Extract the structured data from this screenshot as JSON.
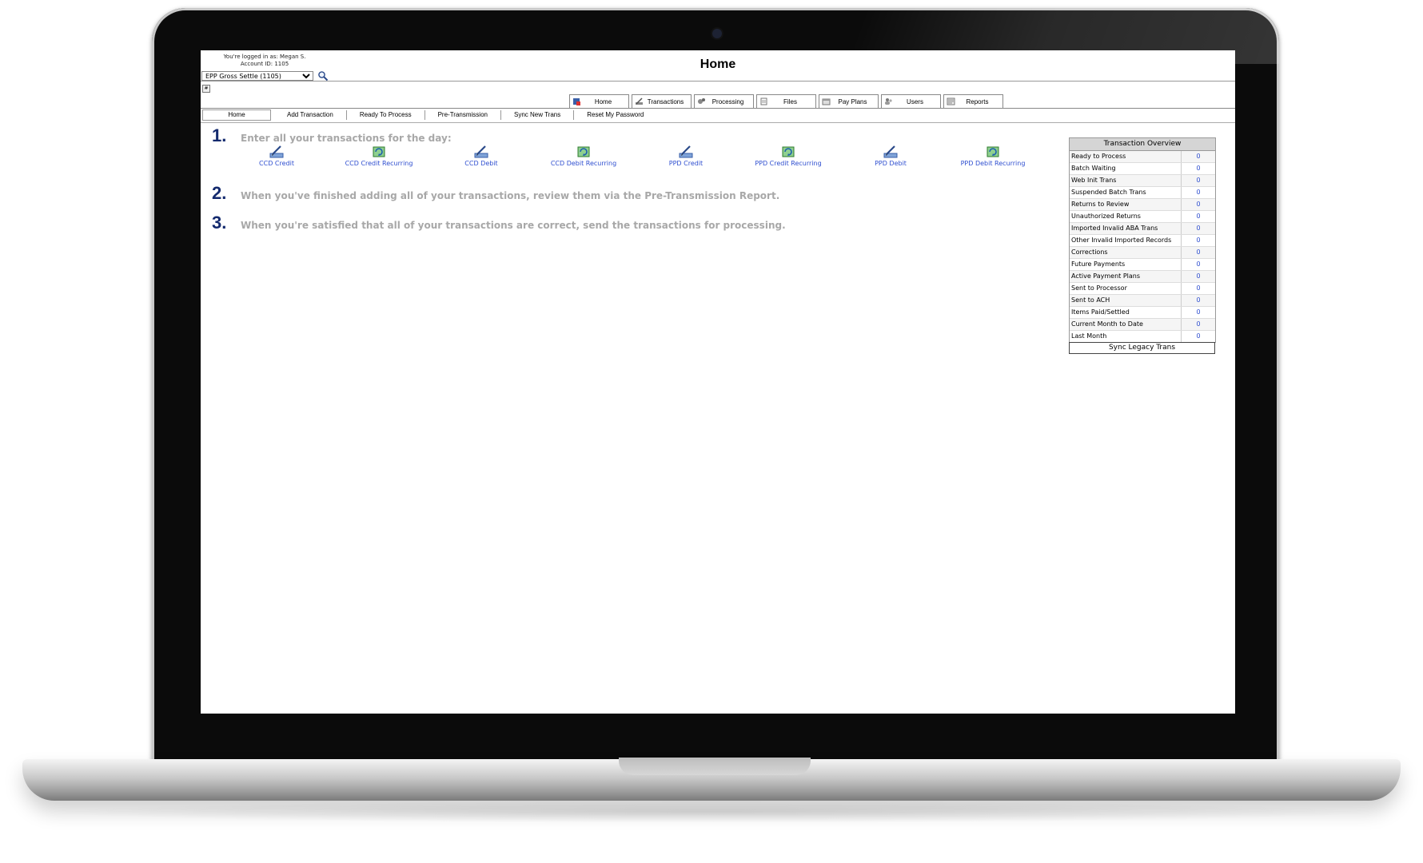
{
  "header": {
    "logged_in_text": "You're logged in as: Megan S.",
    "account_text": "Account ID: 1105",
    "account_selected": "EPP Gross Settle (1105)",
    "page_title": "Home",
    "toggle_glyph": "#"
  },
  "main_tabs": [
    {
      "label": "Home",
      "icon": "house-icon"
    },
    {
      "label": "Transactions",
      "icon": "pencil-icon"
    },
    {
      "label": "Processing",
      "icon": "gears-icon"
    },
    {
      "label": "Files",
      "icon": "document-icon"
    },
    {
      "label": "Pay Plans",
      "icon": "calendar-icon"
    },
    {
      "label": "Users",
      "icon": "users-icon"
    },
    {
      "label": "Reports",
      "icon": "report-icon"
    }
  ],
  "sub_nav": [
    {
      "label": "Home"
    },
    {
      "label": "Add Transaction"
    },
    {
      "label": "Ready To Process"
    },
    {
      "label": "Pre-Transmission"
    },
    {
      "label": "Sync New Trans"
    },
    {
      "label": "Reset My Password"
    }
  ],
  "steps": [
    {
      "num": "1.",
      "text": "Enter all your transactions for the day:"
    },
    {
      "num": "2.",
      "text": "When you've finished adding all of your transactions, review them via the Pre-Transmission Report."
    },
    {
      "num": "3.",
      "text": "When you're satisfied that all of your transactions are correct, send the transactions for processing."
    }
  ],
  "transaction_links": [
    {
      "label": "CCD Credit",
      "icon": "pen-icon"
    },
    {
      "label": "CCD Credit Recurring",
      "icon": "recurring-icon"
    },
    {
      "label": "CCD Debit",
      "icon": "pen-icon"
    },
    {
      "label": "CCD Debit Recurring",
      "icon": "recurring-icon"
    },
    {
      "label": "PPD Credit",
      "icon": "pen-icon"
    },
    {
      "label": "PPD Credit Recurring",
      "icon": "recurring-icon"
    },
    {
      "label": "PPD Debit",
      "icon": "pen-icon"
    },
    {
      "label": "PPD Debit Recurring",
      "icon": "recurring-icon"
    }
  ],
  "overview": {
    "title": "Transaction Overview",
    "rows": [
      {
        "label": "Ready to Process",
        "value": "0"
      },
      {
        "label": "Batch Waiting",
        "value": "0"
      },
      {
        "label": "Web Init Trans",
        "value": "0"
      },
      {
        "label": "Suspended Batch Trans",
        "value": "0"
      },
      {
        "label": "Returns to Review",
        "value": "0"
      },
      {
        "label": "Unauthorized Returns",
        "value": "0"
      },
      {
        "label": "Imported Invalid ABA Trans",
        "value": "0"
      },
      {
        "label": "Other Invalid Imported Records",
        "value": "0"
      },
      {
        "label": "Corrections",
        "value": "0"
      },
      {
        "label": "Future Payments",
        "value": "0"
      },
      {
        "label": "Active Payment Plans",
        "value": "0"
      },
      {
        "label": "Sent to Processor",
        "value": "0"
      },
      {
        "label": "Sent to ACH",
        "value": "0"
      },
      {
        "label": "Items Paid/Settled",
        "value": "0"
      },
      {
        "label": "Current Month to Date",
        "value": "0"
      },
      {
        "label": "Last Month",
        "value": "0"
      }
    ],
    "sync_button": "Sync Legacy Trans"
  },
  "colors": {
    "step_number": "#142a6e",
    "step_text": "#a8a8a8",
    "link": "#2f4fd0"
  }
}
